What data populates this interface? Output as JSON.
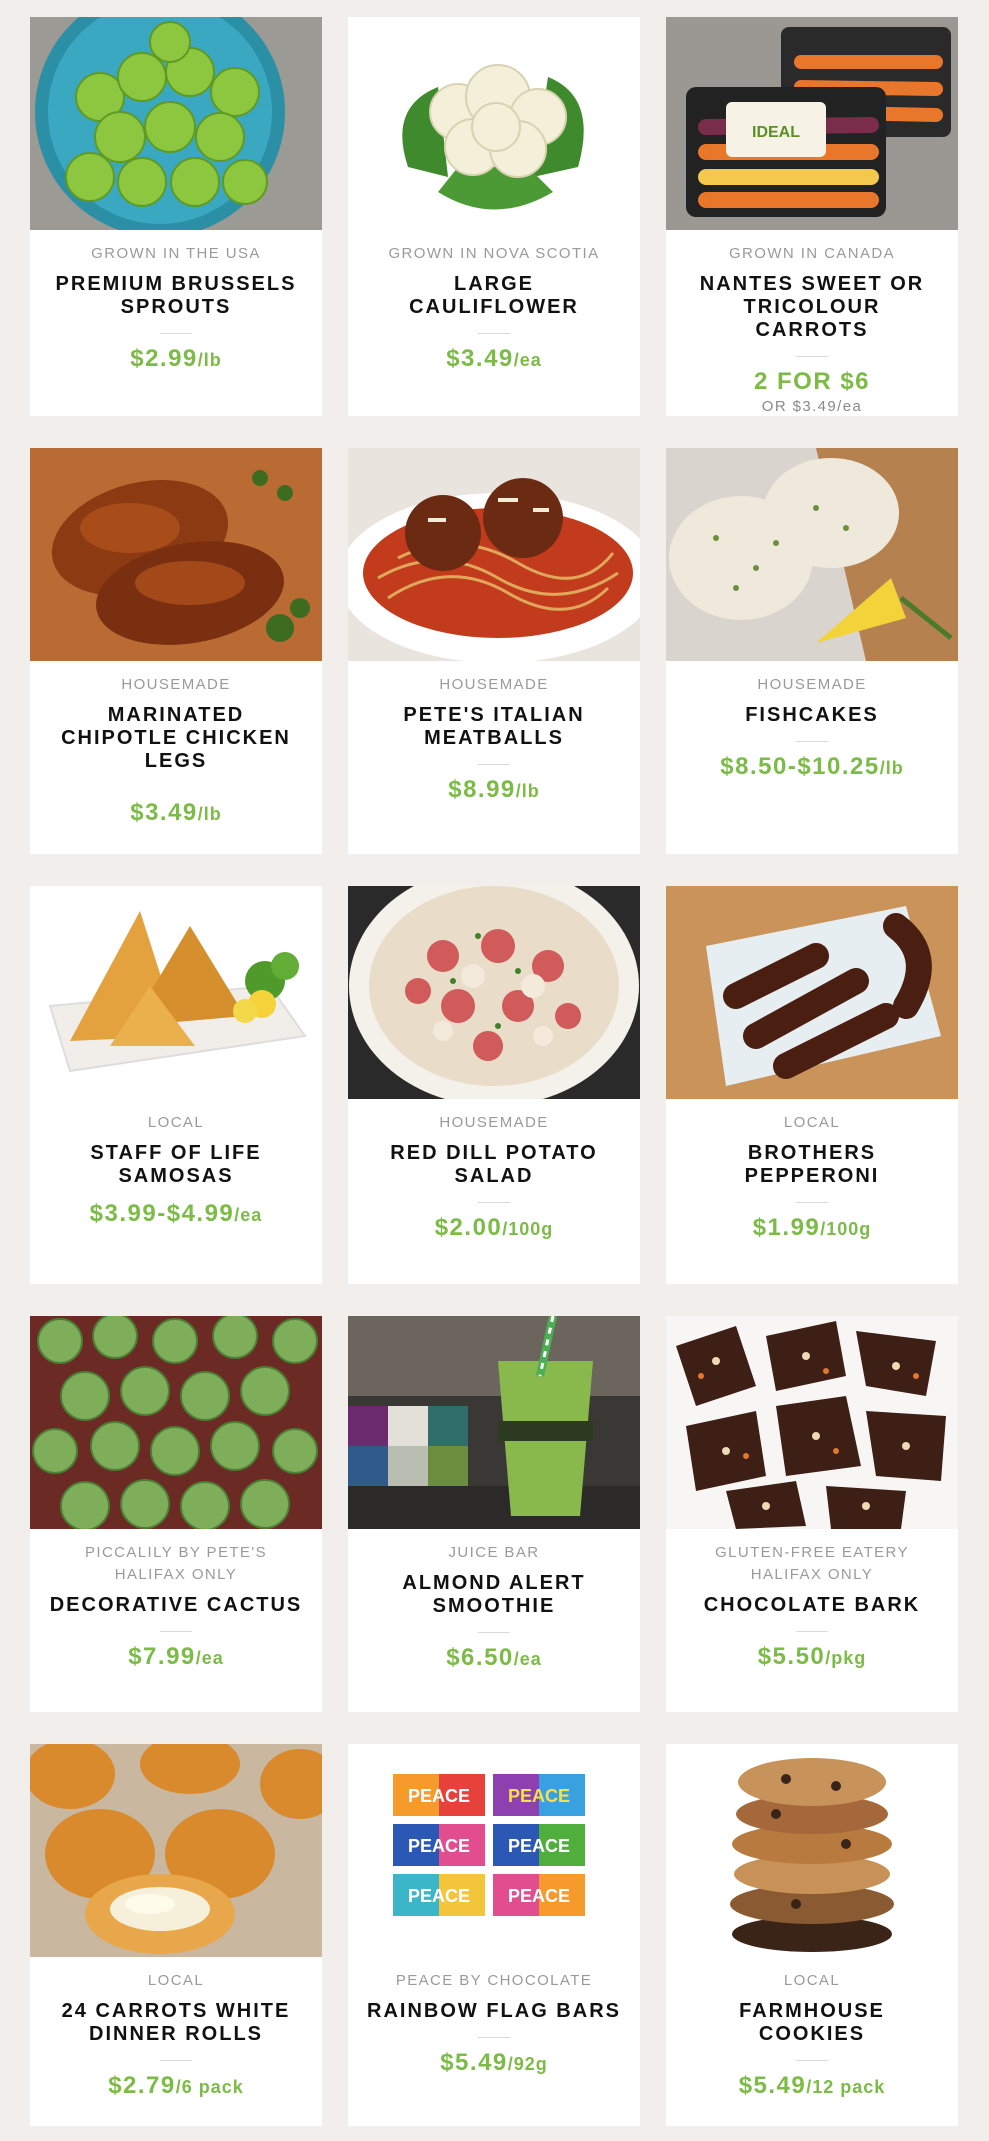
{
  "products": [
    {
      "origin": "GROWN IN THE USA",
      "origin2": "",
      "title": "PREMIUM BRUSSELS SPROUTS",
      "price": "$2.99",
      "unit": "/lb",
      "sub": "",
      "image": "brussels-sprouts-image"
    },
    {
      "origin": "GROWN IN NOVA SCOTIA",
      "origin2": "",
      "title": "LARGE CAULIFLOWER",
      "price": "$3.49",
      "unit": "/ea",
      "sub": "",
      "image": "cauliflower-image"
    },
    {
      "origin": "GROWN IN CANADA",
      "origin2": "",
      "title": "NANTES SWEET OR TRICOLOUR CARROTS",
      "price": "2 FOR $6",
      "unit": "",
      "sub": "OR $3.49/ea",
      "image": "carrots-image"
    },
    {
      "origin": "HOUSEMADE",
      "origin2": "",
      "title": "MARINATED CHIPOTLE CHICKEN LEGS",
      "price": "$3.49",
      "unit": "/lb",
      "sub": "",
      "image": "chicken-legs-image"
    },
    {
      "origin": "HOUSEMADE",
      "origin2": "",
      "title": "PETE'S ITALIAN MEATBALLS",
      "price": "$8.99",
      "unit": "/lb",
      "sub": "",
      "image": "meatballs-image"
    },
    {
      "origin": "HOUSEMADE",
      "origin2": "",
      "title": "FISHCAKES",
      "price": "$8.50-$10.25",
      "unit": "/lb",
      "sub": "",
      "image": "fishcakes-image"
    },
    {
      "origin": "LOCAL",
      "origin2": "",
      "title": "STAFF OF LIFE SAMOSAS",
      "price": "$3.99-$4.99",
      "unit": "/ea",
      "sub": "",
      "image": "samosas-image"
    },
    {
      "origin": "HOUSEMADE",
      "origin2": "",
      "title": "RED DILL POTATO SALAD",
      "price": "$2.00",
      "unit": "/100g",
      "sub": "",
      "image": "potato-salad-image"
    },
    {
      "origin": "LOCAL",
      "origin2": "",
      "title": "BROTHERS PEPPERONI",
      "price": "$1.99",
      "unit": "/100g",
      "sub": "",
      "image": "pepperoni-image"
    },
    {
      "origin": "PICCALILY BY PETE'S",
      "origin2": "HALIFAX ONLY",
      "title": "DECORATIVE CACTUS",
      "price": "$7.99",
      "unit": "/ea",
      "sub": "",
      "image": "cactus-image"
    },
    {
      "origin": "JUICE BAR",
      "origin2": "",
      "title": "ALMOND ALERT SMOOTHIE",
      "price": "$6.50",
      "unit": "/ea",
      "sub": "",
      "image": "smoothie-image"
    },
    {
      "origin": "GLUTEN-FREE EATERY",
      "origin2": "HALIFAX ONLY",
      "title": "CHOCOLATE BARK",
      "price": "$5.50",
      "unit": "/pkg",
      "sub": "",
      "image": "chocolate-bark-image"
    },
    {
      "origin": "LOCAL",
      "origin2": "",
      "title": "24 CARROTS WHITE DINNER ROLLS",
      "price": "$2.79",
      "unit": "/6 pack",
      "sub": "",
      "image": "dinner-rolls-image"
    },
    {
      "origin": "PEACE BY CHOCOLATE",
      "origin2": "",
      "title": "RAINBOW FLAG BARS",
      "price": "$5.49",
      "unit": "/92g",
      "sub": "",
      "image": "rainbow-bars-image"
    },
    {
      "origin": "LOCAL",
      "origin2": "",
      "title": "FARMHOUSE COOKIES",
      "price": "$5.49",
      "unit": "/12 pack",
      "sub": "",
      "image": "cookies-image"
    }
  ],
  "packaging_text": {
    "carrot_brand": "IDEAL",
    "bar_brand": "PEACE"
  },
  "colors": {
    "price": "#7dbb47",
    "background": "#f2eeec",
    "card": "#ffffff"
  }
}
